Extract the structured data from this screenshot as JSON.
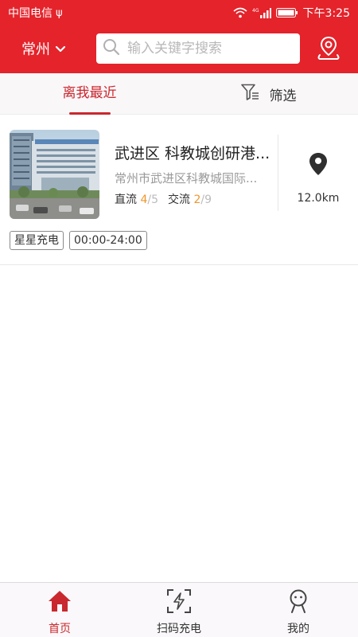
{
  "status_bar": {
    "carrier": "中国电信",
    "usb_glyph": "ψ",
    "network_label": "4G",
    "time": "下午3:25"
  },
  "header": {
    "city": "常州",
    "search_placeholder": "输入关键字搜索"
  },
  "tabs": {
    "nearest": "离我最近",
    "filter": "筛选"
  },
  "stations": [
    {
      "name": "武进区 科教城创研港...",
      "address": "常州市武进区科教城国际...",
      "dc_label": "直流",
      "dc_available": "4",
      "dc_total": "/5",
      "ac_label": "交流",
      "ac_available": "2",
      "ac_total": "/9",
      "distance": "12.0km",
      "tags": [
        "星星充电",
        "00:00-24:00"
      ]
    }
  ],
  "bottom_nav": {
    "home": "首页",
    "scan": "扫码充电",
    "mine": "我的"
  },
  "colors": {
    "brand_red": "#e4232b",
    "active_red": "#c9282e",
    "available_orange": "#f0962a"
  },
  "icons": [
    "wifi-icon",
    "signal-icon",
    "battery-icon",
    "chevron-down-icon",
    "search-icon",
    "location-person-icon",
    "filter-icon",
    "map-pin-icon",
    "home-icon",
    "scan-charge-icon",
    "user-icon"
  ]
}
